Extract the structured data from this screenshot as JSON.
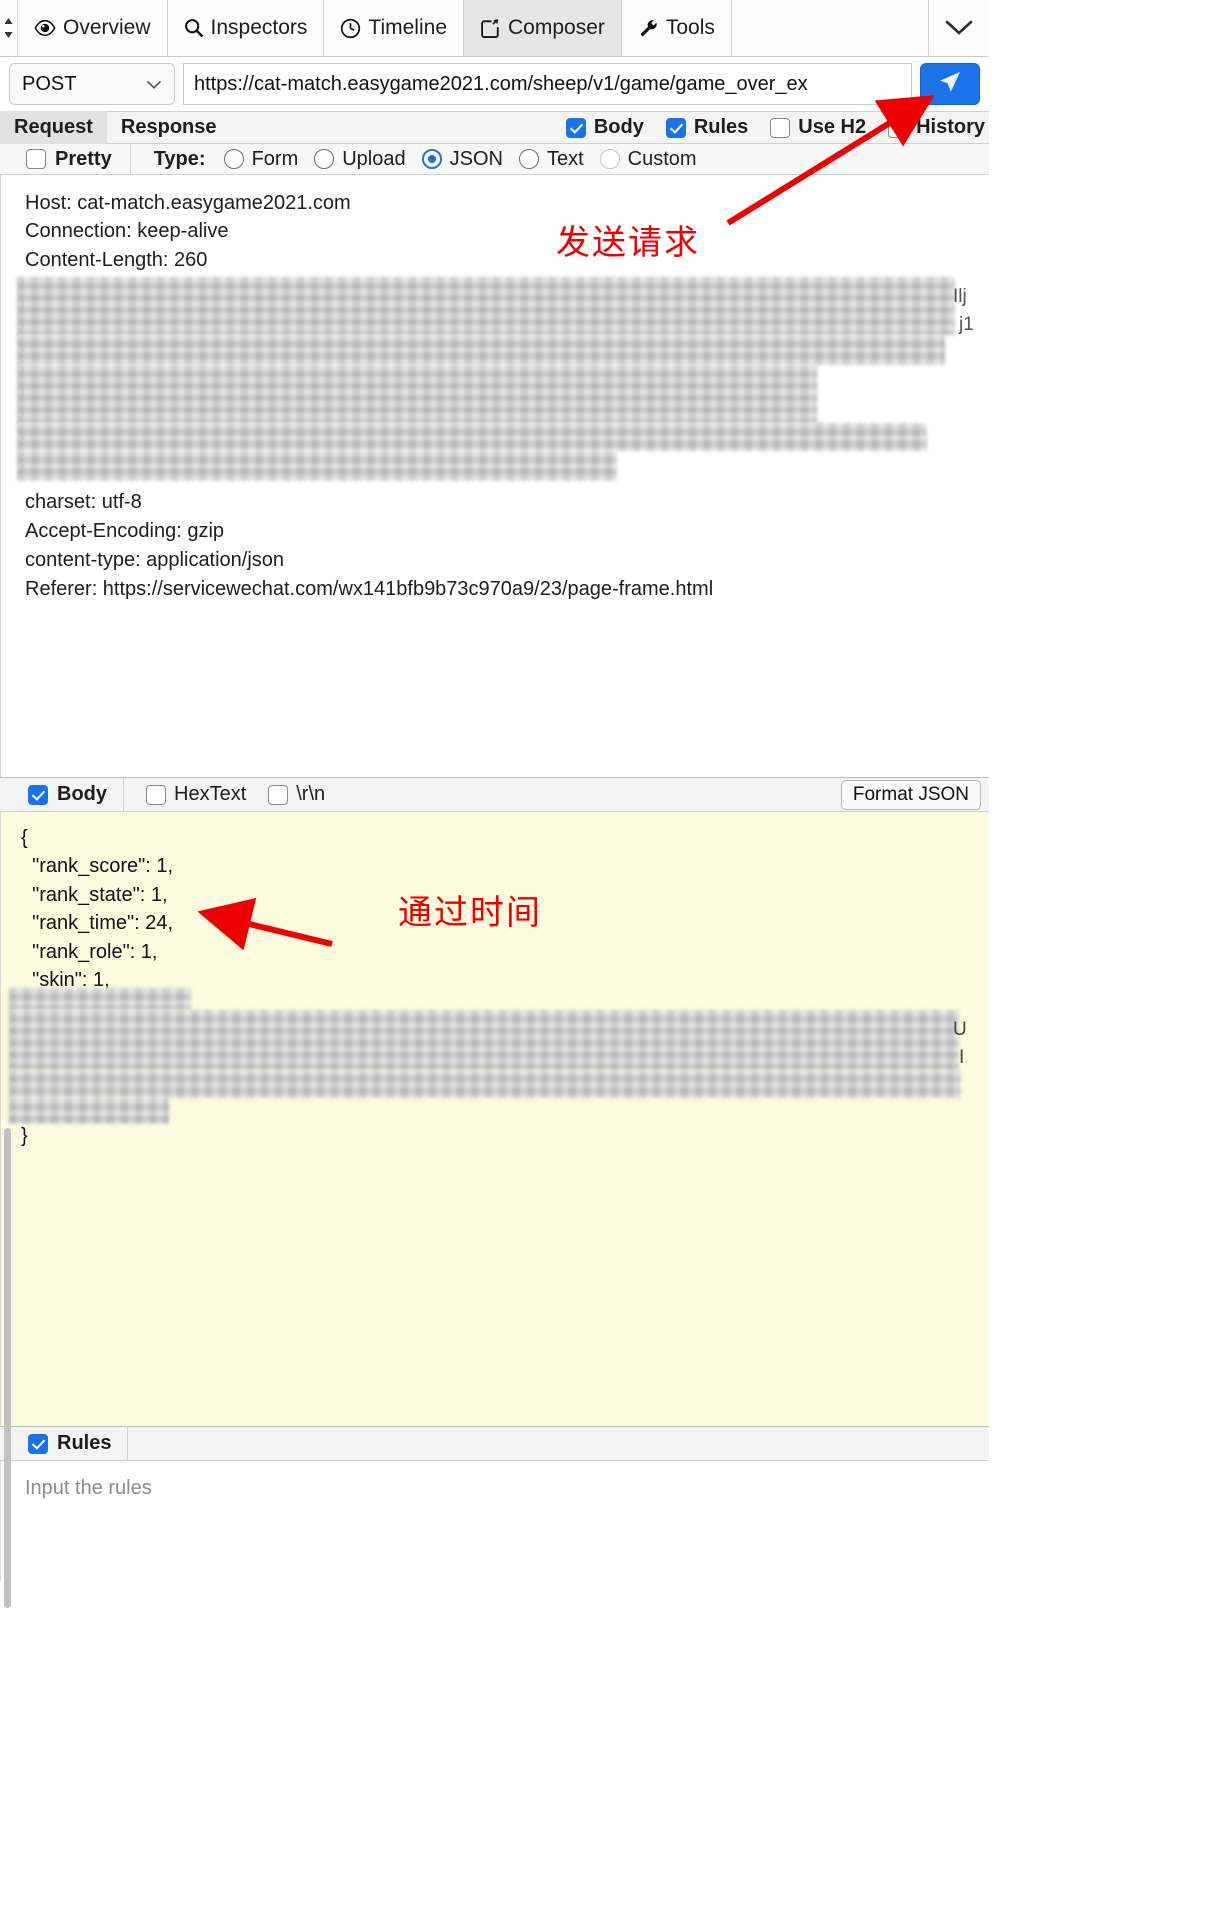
{
  "tabs": [
    {
      "label": "Overview",
      "icon": "eye-icon",
      "active": false
    },
    {
      "label": "Inspectors",
      "icon": "search-icon",
      "active": false
    },
    {
      "label": "Timeline",
      "icon": "clock-icon",
      "active": false
    },
    {
      "label": "Composer",
      "icon": "compose-icon",
      "active": true
    },
    {
      "label": "Tools",
      "icon": "wrench-icon",
      "active": false
    }
  ],
  "url_row": {
    "method": "POST",
    "url": "https://cat-match.easygame2021.com/sheep/v1/game/game_over_ex",
    "url_placeholder": "https://",
    "send_icon": "send-icon"
  },
  "request_response": {
    "tabs": [
      {
        "label": "Request",
        "active": true
      },
      {
        "label": "Response",
        "active": false
      }
    ],
    "options": [
      {
        "label": "Body",
        "checked": true
      },
      {
        "label": "Rules",
        "checked": true
      },
      {
        "label": "Use H2",
        "checked": false
      },
      {
        "label": "History",
        "checked": false
      }
    ]
  },
  "type_row": {
    "pretty": {
      "label": "Pretty",
      "checked": false
    },
    "type_label": "Type:",
    "types": [
      {
        "label": "Form",
        "selected": false,
        "disabled": false
      },
      {
        "label": "Upload",
        "selected": false,
        "disabled": false
      },
      {
        "label": "JSON",
        "selected": true,
        "disabled": false
      },
      {
        "label": "Text",
        "selected": false,
        "disabled": false
      },
      {
        "label": "Custom",
        "selected": false,
        "disabled": true
      }
    ]
  },
  "headers": {
    "lines_top": [
      "Host: cat-match.easygame2021.com",
      "Connection: keep-alive",
      "Content-Length: 260"
    ],
    "lines_bottom": [
      "charset: utf-8",
      "Accept-Encoding: gzip",
      "content-type: application/json",
      "Referer: https://servicewechat.com/wx141bfb9b73c970a9/23/page-frame.html"
    ],
    "redacted_edge_right": [
      "Ilj",
      "j1"
    ]
  },
  "body_section": {
    "body_checkbox": {
      "label": "Body",
      "checked": true
    },
    "options": [
      {
        "label": "HexText",
        "checked": false
      },
      {
        "label": "\\r\\n",
        "checked": false
      }
    ],
    "format_button": "Format JSON",
    "json_lines_top": [
      "{",
      "  \"rank_score\": 1,",
      "  \"rank_state\": 1,",
      "  \"rank_time\": 24,",
      "  \"rank_role\": 1,",
      "  \"skin\": 1,"
    ],
    "json_lines_bottom": [
      "}"
    ],
    "redacted_edge_right": [
      "U",
      "I"
    ]
  },
  "rules_section": {
    "checkbox": {
      "label": "Rules",
      "checked": true
    },
    "placeholder": "Input the rules"
  },
  "annotations": [
    {
      "text": "发送请求",
      "kind": "red-arrow-label"
    },
    {
      "text": "通过时间",
      "kind": "red-arrow-label"
    }
  ],
  "colors": {
    "accent": "#1a73e8",
    "annotation": "#ee0000",
    "body_background": "#fcfadf",
    "active_tab": "#e6e6e6"
  }
}
